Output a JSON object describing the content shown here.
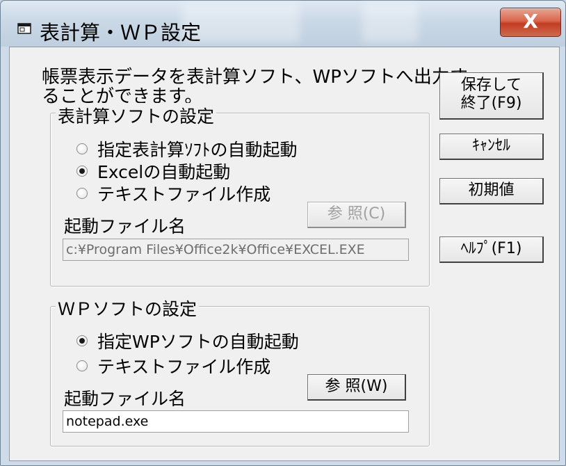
{
  "window": {
    "title": "表計算・ＷＰ設定",
    "close_label": "X"
  },
  "description": {
    "line1": "帳票表示データを表計算ソフト、WPソフトへ出力す",
    "line2": "ることができます。"
  },
  "spreadsheet_group": {
    "title": "表計算ソフトの設定",
    "options": [
      {
        "label": "指定表計算ｿﾌﾄの自動起動",
        "checked": false
      },
      {
        "label": "Excelの自動起動",
        "checked": true
      },
      {
        "label": "テキストファイル作成",
        "checked": false
      }
    ],
    "file_label": "起動ファイル名",
    "browse_label": "参 照(C)",
    "path_value": "c:¥Program Files¥Office2k¥Office¥EXCEL.EXE"
  },
  "wp_group": {
    "title": "ＷＰソフトの設定",
    "options": [
      {
        "label": "指定WPソフトの自動起動",
        "checked": true
      },
      {
        "label": "テキストファイル作成",
        "checked": false
      }
    ],
    "file_label": "起動ファイル名",
    "browse_label": "参 照(W)",
    "path_value": "notepad.exe"
  },
  "buttons": {
    "save_line1": "保存して",
    "save_line2": "終了(F9)",
    "cancel": "ｷｬﾝｾﾙ",
    "defaults": "初期値",
    "help": "ﾍﾙﾌﾟ(F1)"
  }
}
